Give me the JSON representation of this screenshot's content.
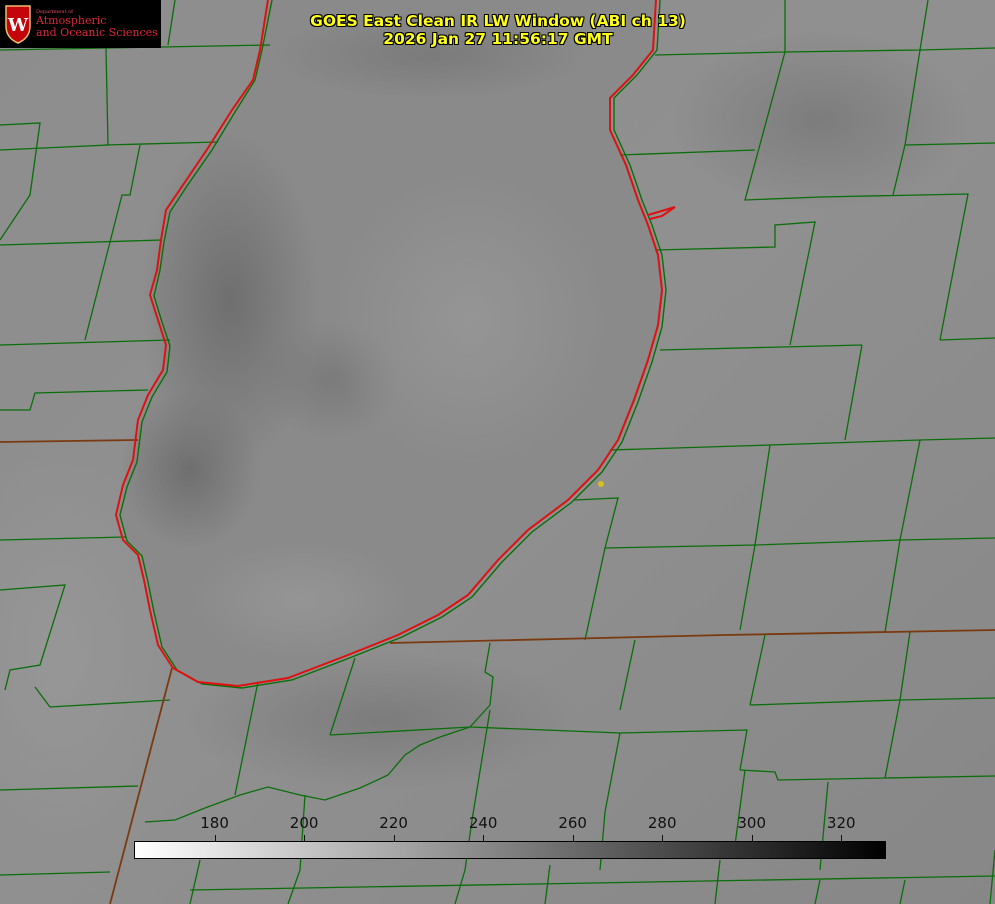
{
  "header": {
    "title_line1": "GOES East Clean IR LW Window (ABI ch 13)",
    "title_line2": "2026 Jan 27 11:56:17 GMT"
  },
  "logo": {
    "dept_label": "Department of",
    "line1": "Atmospheric",
    "line2": "and Oceanic Sciences",
    "crest_letter": "W",
    "crest_color": "#c5050c"
  },
  "colorbar": {
    "vmin": 162,
    "vmax": 330,
    "ticks": [
      {
        "label": "180",
        "value": 180
      },
      {
        "label": "200",
        "value": 200
      },
      {
        "label": "220",
        "value": 220
      },
      {
        "label": "240",
        "value": 240
      },
      {
        "label": "260",
        "value": 260
      },
      {
        "label": "280",
        "value": 280
      },
      {
        "label": "300",
        "value": 300
      },
      {
        "label": "320",
        "value": 320
      }
    ],
    "gradient_start": "#ffffff",
    "gradient_end": "#000000"
  },
  "colors": {
    "land_gray": "#8c8c8c",
    "lake_gray": "#8a8a8a",
    "cloud_dark": "#6e6e6e",
    "county_line": "#0a6e0a",
    "state_line": "#7a3a10",
    "coastline": "#e01010",
    "marker": "#d4c21a"
  }
}
